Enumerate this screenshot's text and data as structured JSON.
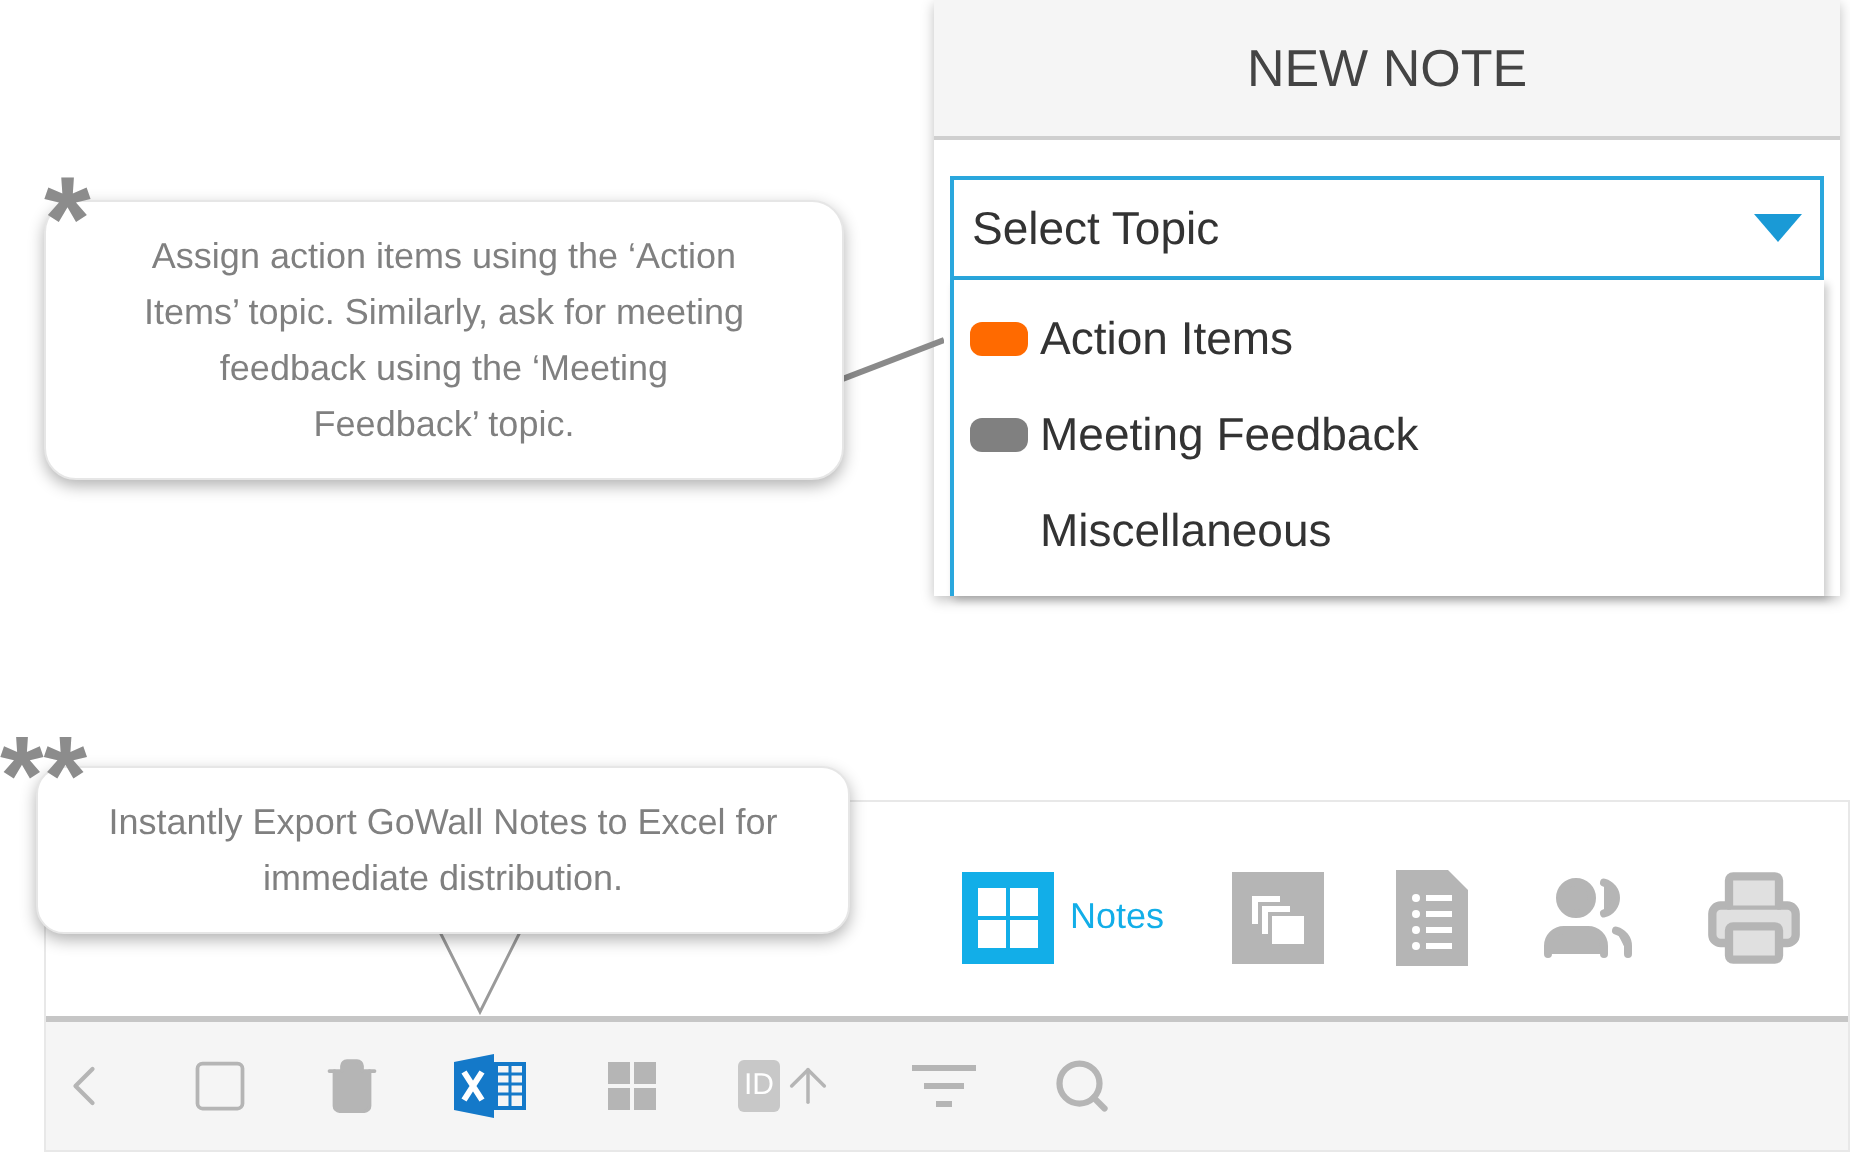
{
  "callouts": [
    {
      "mark": "*",
      "text": "Assign action items using the ‘Action Items’ topic.  Similarly, ask for meeting feedback using the ‘Meeting Feedback’ topic."
    },
    {
      "mark": "**",
      "text": "Instantly Export GoWall Notes to Excel for immediate distribution."
    }
  ],
  "new_note": {
    "title": "NEW NOTE",
    "select": {
      "placeholder": "Select Topic"
    },
    "options": [
      {
        "label": "Action Items",
        "color": "#ff6a00"
      },
      {
        "label": "Meeting Feedback",
        "color": "#808080"
      },
      {
        "label": "Miscellaneous"
      }
    ]
  },
  "view_tabs": [
    {
      "kind": "notes",
      "label": "Notes",
      "selected": true
    },
    {
      "kind": "stack",
      "selected": false
    },
    {
      "kind": "list",
      "selected": false
    },
    {
      "kind": "people",
      "selected": false
    },
    {
      "kind": "print",
      "selected": false
    }
  ],
  "toolbar": [
    {
      "kind": "back"
    },
    {
      "kind": "select"
    },
    {
      "kind": "delete"
    },
    {
      "kind": "excel"
    },
    {
      "kind": "grid"
    },
    {
      "kind": "sort",
      "badge": "ID"
    },
    {
      "kind": "filter"
    },
    {
      "kind": "search"
    }
  ]
}
